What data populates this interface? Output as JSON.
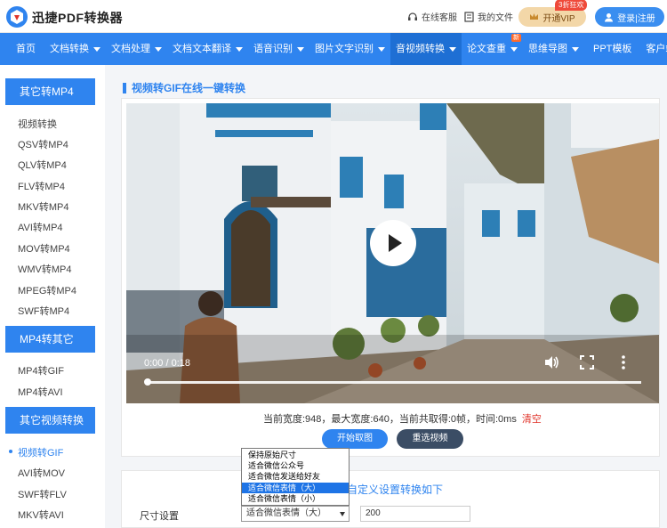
{
  "header": {
    "brand": "迅捷PDF转换器",
    "online_service": "在线客服",
    "my_files": "我的文件",
    "vip_label": "开通VIP",
    "vip_badge": "3折狂欢",
    "login": "登录|注册"
  },
  "nav": {
    "items": [
      {
        "label": "首页"
      },
      {
        "label": "文档转换"
      },
      {
        "label": "文档处理"
      },
      {
        "label": "文档文本翻译"
      },
      {
        "label": "语音识别"
      },
      {
        "label": "图片文字识别"
      },
      {
        "label": "音视频转换"
      },
      {
        "label": "论文查重"
      },
      {
        "label": "思维导图"
      },
      {
        "label": "PPT模板"
      },
      {
        "label": "客户端"
      }
    ],
    "new_badge": "新"
  },
  "sidebar": {
    "sections": [
      {
        "title": "其它转MP4",
        "items": [
          "视频转换",
          "QSV转MP4",
          "QLV转MP4",
          "FLV转MP4",
          "MKV转MP4",
          "AVI转MP4",
          "MOV转MP4",
          "WMV转MP4",
          "MPEG转MP4",
          "SWF转MP4"
        ]
      },
      {
        "title": "MP4转其它",
        "items": [
          "MP4转GIF",
          "MP4转AVI"
        ]
      },
      {
        "title": "其它视频转换",
        "items": [
          "视频转GIF",
          "AVI转MOV",
          "SWF转FLV",
          "MKV转AVI"
        ]
      }
    ]
  },
  "main": {
    "title": "视频转GIF在线一键转换",
    "video": {
      "time": "0:00 / 0:18",
      "progress": 0.0
    },
    "stats": "当前宽度:948，最大宽度:640，当前共取得:0帧，时间:0ms",
    "clear": "清空",
    "start_button": "开始取图",
    "reselect_button": "重选视频",
    "custom_title": "自定义设置转换如下",
    "size_label": "尺寸设置",
    "size_selected": "适合微信表情（大）",
    "size_options": [
      "保持原始尺寸",
      "适合微信公众号",
      "适合微信发送给好友",
      "适合微信表情（大）",
      "适合微信表情（小）"
    ],
    "width_value": "200"
  },
  "colors": {
    "accent": "#2f84ef",
    "danger": "#e0342a"
  }
}
